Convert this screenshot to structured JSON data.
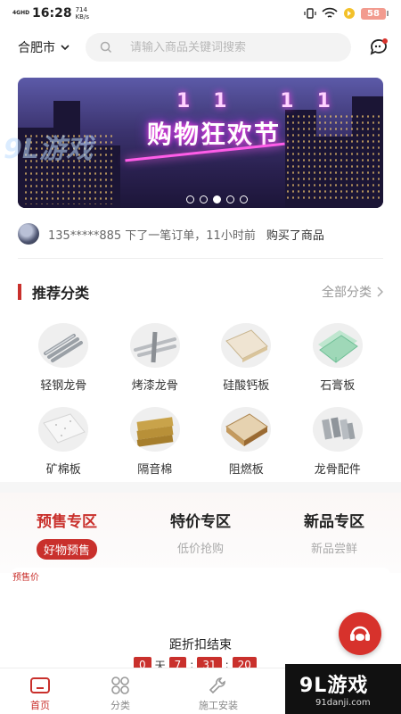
{
  "status_bar": {
    "network": "4GHD",
    "time": "16:28",
    "speed": "714 KB/s",
    "battery": "58"
  },
  "header": {
    "city": "合肥市",
    "search_placeholder": "请输入商品关键词搜索"
  },
  "banner": {
    "eleven": "11 11",
    "title": "购物狂欢节",
    "slide_count": 5,
    "active_slide": 3
  },
  "ticker": {
    "user": "135*****885",
    "action": "下了一笔订单，11小时前",
    "result": "购买了商品"
  },
  "recommend": {
    "title": "推荐分类",
    "all_label": "全部分类",
    "categories": [
      {
        "label": "轻钢龙骨",
        "icon": "light-steel-keel"
      },
      {
        "label": "烤漆龙骨",
        "icon": "painted-keel"
      },
      {
        "label": "硅酸钙板",
        "icon": "calcium-silicate-board"
      },
      {
        "label": "石膏板",
        "icon": "gypsum-board"
      },
      {
        "label": "矿棉板",
        "icon": "mineral-wool-board"
      },
      {
        "label": "隔音棉",
        "icon": "sound-insulation-cotton"
      },
      {
        "label": "阻燃板",
        "icon": "fire-retardant-board"
      },
      {
        "label": "龙骨配件",
        "icon": "keel-accessories"
      }
    ]
  },
  "zones": [
    {
      "title": "预售专区",
      "subtitle": "好物预售",
      "active": true
    },
    {
      "title": "特价专区",
      "subtitle": "低价抢购",
      "active": false
    },
    {
      "title": "新品专区",
      "subtitle": "新品尝鲜",
      "active": false
    }
  ],
  "presale_card": {
    "tag": "预售价",
    "countdown_title": "距折扣结束",
    "days": "0",
    "day_unit": "天",
    "hours": "7",
    "minutes": "31",
    "seconds": "20",
    "sep": ":"
  },
  "nav": {
    "items": [
      {
        "label": "首页",
        "icon": "home-icon",
        "active": true
      },
      {
        "label": "分类",
        "icon": "category-icon",
        "active": false
      },
      {
        "label": "施工安装",
        "icon": "wrench-icon",
        "active": false
      }
    ]
  },
  "watermark": {
    "big": "9L游戏",
    "small": "91danji.com",
    "banner_mark": "9L游戏"
  },
  "colors": {
    "accent": "#c9302c",
    "battery": "#f29b8f"
  }
}
